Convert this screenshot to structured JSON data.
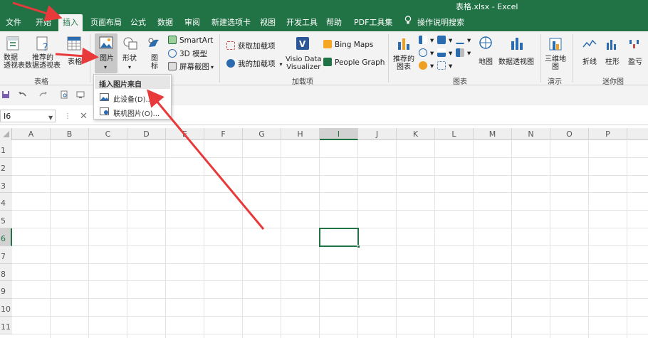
{
  "window": {
    "title": "表格.xlsx  -  Excel"
  },
  "tabs": [
    "文件",
    "开始",
    "插入",
    "页面布局",
    "公式",
    "数据",
    "审阅",
    "新建选项卡",
    "视图",
    "开发工具",
    "帮助",
    "PDF工具集"
  ],
  "active_tab": "插入",
  "tell_me": "操作说明搜索",
  "ribbon": {
    "tables": {
      "pivot_table": "数据\n透视表",
      "recommended_pivot": "推荐的\n数据透视表",
      "table": "表格",
      "group_label": "表格"
    },
    "illustrations": {
      "pictures": "图片",
      "shapes": "形状",
      "icons": "图\n标",
      "smartart": "SmartArt",
      "models_3d": "3D 模型",
      "screenshot": "屏幕截图"
    },
    "addins": {
      "get_addins": "获取加载项",
      "my_addins": "我的加载项",
      "visio": "Visio Data\nVisualizer",
      "bing_maps": "Bing Maps",
      "people_graph": "People Graph",
      "group_label": "加载项"
    },
    "charts": {
      "recommended": "推荐的\n图表",
      "map": "地图",
      "pivot_chart": "数据透视图",
      "group_label": "图表"
    },
    "tours": {
      "map_3d": "三维地\n图",
      "group_label": "演示"
    },
    "sparklines": {
      "line": "折线",
      "column": "柱形",
      "win_loss": "盈亏",
      "group_label": "迷你图"
    }
  },
  "namebox": "I6",
  "formula_cancel": "✕",
  "columns": [
    "A",
    "B",
    "C",
    "D",
    "E",
    "F",
    "G",
    "H",
    "I",
    "J",
    "K",
    "L",
    "M",
    "N",
    "O",
    "P"
  ],
  "rows": [
    "1",
    "2",
    "3",
    "4",
    "5",
    "6",
    "7",
    "8",
    "9",
    "10",
    "11"
  ],
  "selected_column": "I",
  "selected_row": "6",
  "dropdown": {
    "header": "插入图片来自",
    "items": [
      "此设备(D)...",
      "联机图片(O)..."
    ]
  },
  "colors": {
    "accent": "#217346",
    "annotation": "#e8393b"
  }
}
